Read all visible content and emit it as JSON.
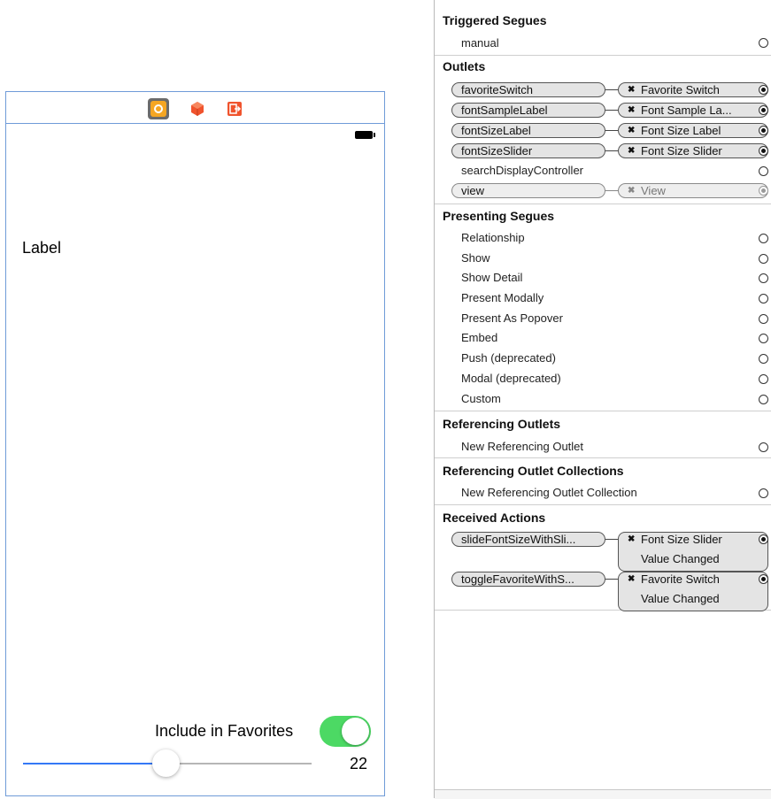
{
  "scene": {
    "label": "Label",
    "favorite_text": "Include in Favorites",
    "switch_on": true,
    "slider_fraction": 0.49,
    "slider_value": "22",
    "accent_color": "#3478f6",
    "switch_color": "#4cd964"
  },
  "inspector": {
    "triggered_segues": {
      "title": "Triggered Segues",
      "rows": [
        {
          "label": "manual"
        }
      ]
    },
    "outlets": {
      "title": "Outlets",
      "connected": [
        {
          "source": "favoriteSwitch",
          "target": "Favorite Switch"
        },
        {
          "source": "fontSampleLabel",
          "target": "Font Sample La..."
        },
        {
          "source": "fontSizeLabel",
          "target": "Font Size Label"
        },
        {
          "source": "fontSizeSlider",
          "target": "Font Size Slider"
        }
      ],
      "unconnected": "searchDisplayController",
      "view": {
        "source": "view",
        "target": "View"
      }
    },
    "presenting_segues": {
      "title": "Presenting Segues",
      "rows": [
        "Relationship",
        "Show",
        "Show Detail",
        "Present Modally",
        "Present As Popover",
        "Embed",
        "Push (deprecated)",
        "Modal (deprecated)",
        "Custom"
      ]
    },
    "referencing_outlets": {
      "title": "Referencing Outlets",
      "row": "New Referencing Outlet"
    },
    "referencing_collections": {
      "title": "Referencing Outlet Collections",
      "row": "New Referencing Outlet Collection"
    },
    "received_actions": {
      "title": "Received Actions",
      "actions": [
        {
          "source": "slideFontSizeWithSli...",
          "target": "Font Size Slider",
          "event": "Value Changed"
        },
        {
          "source": "toggleFavoriteWithS...",
          "target": "Favorite Switch",
          "event": "Value Changed"
        }
      ]
    }
  }
}
